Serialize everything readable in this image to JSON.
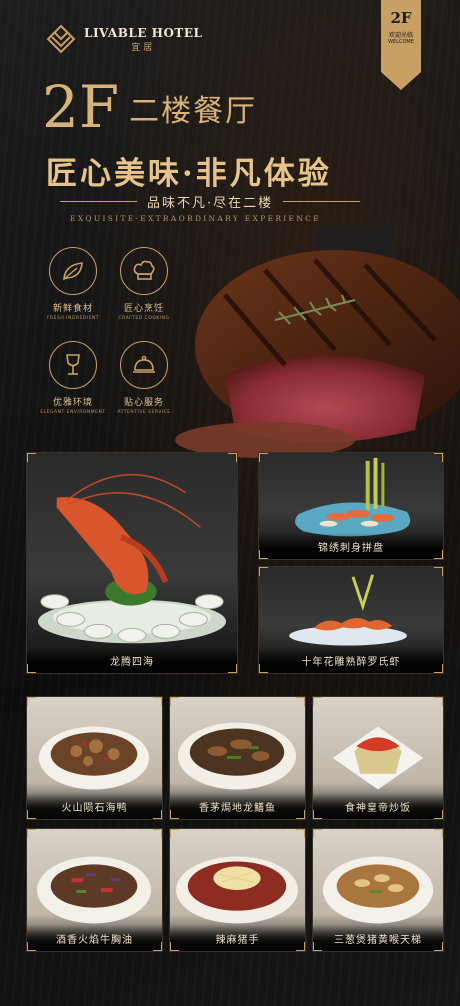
{
  "brand": {
    "name_en": "LIVABLE HOTEL",
    "name_cn": "宜居"
  },
  "badge": {
    "floor": "2F",
    "welcome_cn": "欢迎光临",
    "welcome_en": "WELCOME"
  },
  "hero": {
    "floor": "2F",
    "floor_name": "二楼餐厅",
    "slogan": "匠心美味·非凡体验",
    "sub_slogan": "品味不凡·尽在二楼",
    "en_slogan": "EXQUISITE·EXTRAORDINARY EXPERIENCE"
  },
  "features": [
    {
      "cn": "新鲜食材",
      "en": "FRESH INGREDIENT",
      "icon": "leaf-icon"
    },
    {
      "cn": "匠心烹饪",
      "en": "CRAFTED COOKING",
      "icon": "chef-hat-icon"
    },
    {
      "cn": "优雅环境",
      "en": "ELEGANT ENVIRONMENT",
      "icon": "wine-glass-icon"
    },
    {
      "cn": "贴心服务",
      "en": "ATTENTIVE SERVICE",
      "icon": "service-bell-icon"
    }
  ],
  "dishes": [
    {
      "name": "龙腾四海"
    },
    {
      "name": "锦绣刺身拼盘"
    },
    {
      "name": "十年花雕熟醉罗氏虾"
    },
    {
      "name": "火山陨石海鸭"
    },
    {
      "name": "香茅焗地龙鳝鱼"
    },
    {
      "name": "食神皇帝炒饭"
    },
    {
      "name": "酒香火焰牛胸油"
    },
    {
      "name": "辣麻猪手"
    },
    {
      "name": "三葱煲猪黄喉天梯"
    }
  ],
  "colors": {
    "gold": "#c9a063",
    "background": "#141414"
  }
}
